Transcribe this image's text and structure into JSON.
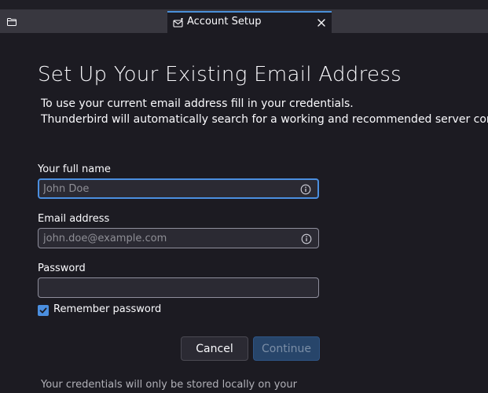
{
  "tab": {
    "title": "Account Setup",
    "icon": "account-setup-icon",
    "close_icon": "close-icon"
  },
  "toolbar": {
    "folder_icon": "folder-icon"
  },
  "page": {
    "heading": "Set Up Your Existing Email Address",
    "intro_line1": "To use your current email address fill in your credentials.",
    "intro_line2": "Thunderbird will automatically search for a working and recommended server configuration."
  },
  "form": {
    "full_name": {
      "label": "Your full name",
      "value": "",
      "placeholder": "John Doe",
      "focused": true
    },
    "email": {
      "label": "Email address",
      "value": "",
      "placeholder": "john.doe@example.com"
    },
    "password": {
      "label": "Password",
      "value": ""
    },
    "remember": {
      "label": "Remember password",
      "checked": true
    }
  },
  "buttons": {
    "cancel": "Cancel",
    "continue": "Continue"
  },
  "footer": {
    "note": "Your credentials will only be stored locally on your"
  },
  "colors": {
    "accent": "#4b8fe0",
    "background": "#1c1b22",
    "field_background": "#2b2a33",
    "continue_disabled": "#27456a"
  }
}
